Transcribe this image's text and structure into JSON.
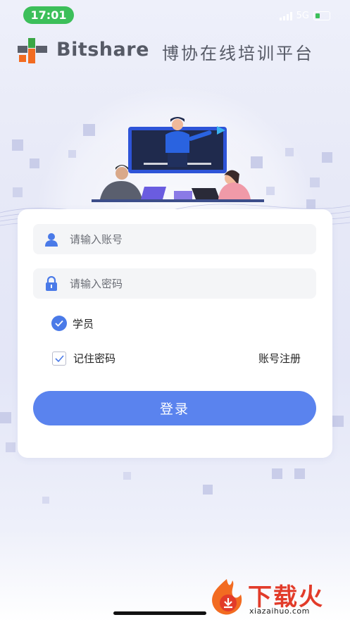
{
  "status_bar": {
    "time": "17:01",
    "network": "5G"
  },
  "brand": {
    "name": "Bitshare",
    "subtitle": "博协在线培训平台"
  },
  "login_form": {
    "account_placeholder": "请输入账号",
    "password_placeholder": "请输入密码",
    "role_label": "学员",
    "role_selected": true,
    "remember_label": "记住密码",
    "remember_checked": true,
    "register_link": "账号注册",
    "login_button": "登录"
  },
  "watermark": {
    "title": "下载火",
    "url": "xiazaihuo.com"
  },
  "colors": {
    "primary": "#5a83ee",
    "radio": "#4a7ae8",
    "time_pill": "#3cbf5a",
    "input_bg": "#f4f5f7",
    "watermark_red": "#e23b2a",
    "logo_orange": "#f26b21",
    "logo_green": "#3aa645",
    "logo_gray": "#5b5f6b"
  },
  "icons": [
    "user-icon",
    "lock-icon",
    "check-icon",
    "signal-icon",
    "battery-icon",
    "logo-mark-icon",
    "download-flame-icon"
  ]
}
